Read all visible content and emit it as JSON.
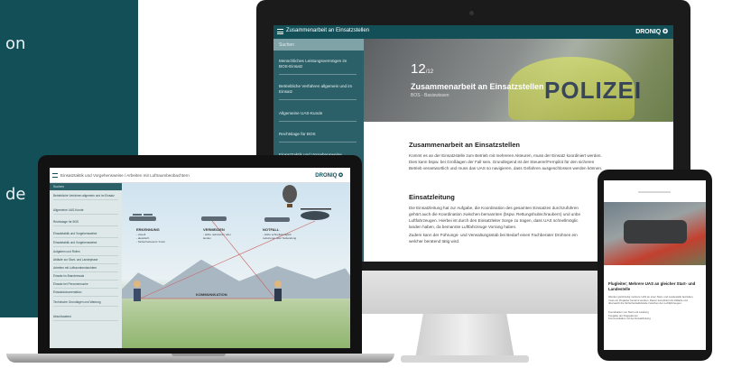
{
  "left_panel": {
    "text_top": "on",
    "text_bottom": "de"
  },
  "imac": {
    "window_title": "Zusammenarbeit an Einsatzstellen",
    "brand": "DRONIQ ✪",
    "search_placeholder": "Suchen",
    "sidebar_items": [
      "Menschliches Leistungsvermögen im BOS-Einsatz",
      "Betriebliche Verfahren allgemein und im Einsatz",
      "Allgemeine UAS-Kunde",
      "Rechtslage für BOS",
      "Einsatztaktik und Vorgehensweise"
    ],
    "hero": {
      "number": "12",
      "total": "/12",
      "title": "Zusammenarbeit an Einsatzstellen",
      "subtitle": "BOS - Basiswissen",
      "photo_text": "POLIZEI"
    },
    "section1_title": "Zusammenarbeit an Einsatzstellen",
    "section1_text": [
      "Kommt es an der Einsatzstelle zum Betrieb mit mehreren Akteuren, muss der Einsatz koordiniert werden.",
      "Dies kann bspw. bei Großlagen der Fall sein. Grundlegend ist der Steuerer/Fernpilot für den sicheren",
      "Betrieb verantwortlich und muss das UAS so navigieren, dass Gefahren ausgeschlossen werden können."
    ],
    "section2_title": "Einsatzleitung",
    "section2_text": [
      "Die Einsatzleitung hat zur Aufgabe, die Koordination des gesamten Einsatzes durchzuführen",
      "gehört auch die Koordination zwischen bemannten (bspw. Rettungshubschraubern) und unbe",
      "Luftfahrzeugen. Hierbei ist durch den Einsatzleiter Sorge zu tragen, dass UAS schnellmöglic",
      "landen haben, da bemannte Luftfahrzeuge Vorrang haben.",
      "Zudem kann der Führungs- und Verwaltungsstab bei Bedarf einen Fachberater Drohnen ein",
      "welcher beratend tätig wird."
    ]
  },
  "laptop": {
    "window_title": "Einsatztaktik und Vorgehensweise / Arbeiten mit Luftraumbeobachtern",
    "brand": "DRONIQ ✪",
    "search_placeholder": "Suchen",
    "sidebar_items": [
      "Betriebliche Verfahren allgemein und im Einsatz",
      "Allgemeine UAS-Kunde",
      "Rechtslage für BOS",
      "Einsatztaktik und Vorgehensweise",
      "Einsatztaktik und Vorgehensweise",
      "Aufgaben und Rollen",
      "Abläufe zur Start- und Landephase",
      "Arbeiten mit Luftraumbeobachtern",
      "Einsatz im Brandeinsatz",
      "Einsatz bei Personensuche",
      "Einsatzdokumentation",
      "Technische Grundlagen und Wartung",
      "Abschlusstest"
    ],
    "illustration": {
      "label_1": "ERKENNUNG",
      "label_1_sub": "- visuell\n- akustisch\n- Sicherheitsrand / Funk",
      "label_2": "VERMEIDEN",
      "label_2_sub": "- Höhe reduzieren oder landen",
      "label_3": "NOTFALL",
      "label_3_sub": "- Höhe schnellstmöglich reduzieren oder Notlandung",
      "label_4": "KOMMUNIKATION"
    }
  },
  "phone": {
    "title": "Flugleiter; Mehrere UAS an gleicher Start- und Landestelle",
    "paragraph": [
      "Werden gleichzeitig mehrere UAS an einer Start- und Landestelle betrieben,",
      "muss ein Flugleiter benannt werden. Dieser koordiniert die Abläufe und",
      "überwacht die Sicherheitsabstände zwischen den Luftfahrzeugen."
    ],
    "bullets": [
      "Koordination von Start und Landung",
      "Freigabe der Flugsektoren",
      "Kommunikation mit der Einsatzleitung"
    ]
  }
}
